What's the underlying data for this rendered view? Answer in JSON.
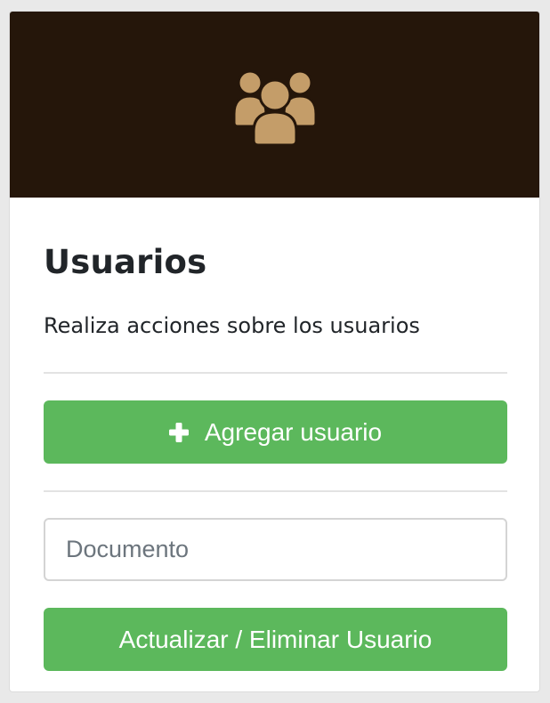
{
  "card": {
    "header_icon": "users-group-icon",
    "title": "Usuarios",
    "subtitle": "Realiza acciones sobre los usuarios",
    "add_button": {
      "icon": "plus-icon",
      "label": "Agregar usuario"
    },
    "document_input": {
      "value": "",
      "placeholder": "Documento"
    },
    "update_button": {
      "label": "Actualizar / Eliminar Usuario"
    }
  },
  "colors": {
    "page_background": "#e9e9e9",
    "header_background": "#25160a",
    "icon_color": "#c49d69",
    "button_green": "#5cb85c",
    "text_dark": "#212529"
  }
}
